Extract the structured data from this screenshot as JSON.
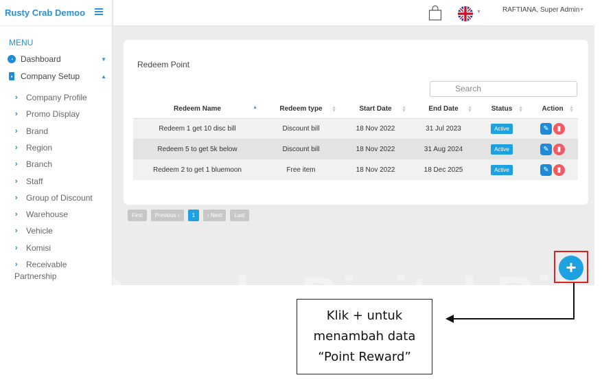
{
  "app": {
    "brand": "Rusty Crab Demoo"
  },
  "sidebar": {
    "menu_label": "MENU",
    "top_items": [
      {
        "label": "Dashboard",
        "icon": "dashboard-icon"
      },
      {
        "label": "Company Setup",
        "icon": "building-icon"
      }
    ],
    "sub_items": [
      {
        "label": "Company Profile"
      },
      {
        "label": "Promo Display"
      },
      {
        "label": "Brand"
      },
      {
        "label": "Region"
      },
      {
        "label": "Branch"
      },
      {
        "label": "Staff"
      },
      {
        "label": "Group of Discount"
      },
      {
        "label": "Warehouse"
      },
      {
        "label": "Vehicle"
      },
      {
        "label": "Komisi"
      },
      {
        "label": "Receivable"
      }
    ],
    "sub_item_continuation": "Partnership"
  },
  "header": {
    "user": "RAFTIANA, Super Admin"
  },
  "card": {
    "title": "Redeem Point",
    "search_placeholder": "Search",
    "columns": [
      "Redeem Name",
      "Redeem type",
      "Start Date",
      "End Date",
      "Status",
      "Action"
    ],
    "rows": [
      {
        "name": "Redeem 1 get 10 disc bill",
        "type": "Discount bill",
        "start": "18 Nov 2022",
        "end": "31 Jul 2023",
        "status": "Active"
      },
      {
        "name": "Redeem 5 to get 5k below",
        "type": "Discount bill",
        "start": "18 Nov 2022",
        "end": "31 Aug 2024",
        "status": "Active"
      },
      {
        "name": "Redeem 2 to get 1 bluemoon",
        "type": "Free item",
        "start": "18 Nov 2022",
        "end": "18 Dec 2025",
        "status": "Active"
      }
    ]
  },
  "pagination": {
    "first": "First",
    "previous": "Previous",
    "page": "1",
    "next": "Next",
    "last": "Last"
  },
  "fab": {
    "symbol": "+"
  },
  "watermark": "ri Garuda Digital Ritel",
  "annotation": {
    "line1": "Klik + untuk",
    "line2": "menambah data",
    "line3": "“Point Reward”"
  },
  "colors": {
    "accent": "#1ea1e0",
    "brand": "#2a8fd6",
    "delete": "#f05a63",
    "highlight_frame": "#e0201c"
  }
}
